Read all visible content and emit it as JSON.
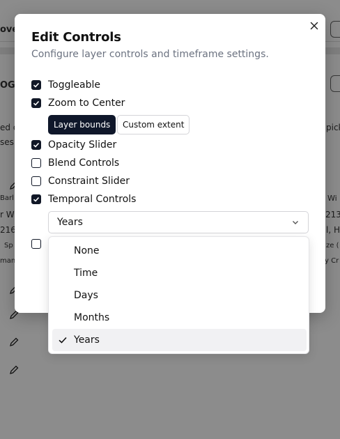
{
  "background": {
    "fragments": [
      "ove",
      "OGs",
      "ed o",
      "ses",
      "Barl",
      "r W",
      "216",
      "Sp",
      "man",
      "pick",
      "Wi",
      "213",
      "l, H",
      "ze (",
      "y Cr"
    ]
  },
  "modal": {
    "title": "Edit Controls",
    "subtitle": "Configure layer controls and timeframe settings.",
    "close_icon": "close-icon",
    "options": [
      {
        "label": "Toggleable",
        "checked": true
      },
      {
        "label": "Zoom to Center",
        "checked": true
      },
      {
        "label": "Opacity Slider",
        "checked": true
      },
      {
        "label": "Blend Controls",
        "checked": false
      },
      {
        "label": "Constraint Slider",
        "checked": false
      },
      {
        "label": "Temporal Controls",
        "checked": true
      }
    ],
    "zoom_buttons": {
      "layer_bounds": "Layer bounds",
      "custom_extent": "Custom extent"
    },
    "timeframe_select": {
      "value": "Years",
      "icon": "chevron-down-icon"
    }
  },
  "dropdown": {
    "items": [
      "None",
      "Time",
      "Days",
      "Months",
      "Years"
    ],
    "selected": "Years",
    "selected_icon": "check-icon"
  },
  "colors": {
    "primary": "#0f172a",
    "muted_text": "#6b7280",
    "overlay": "rgba(0,0,0,0.45)"
  }
}
